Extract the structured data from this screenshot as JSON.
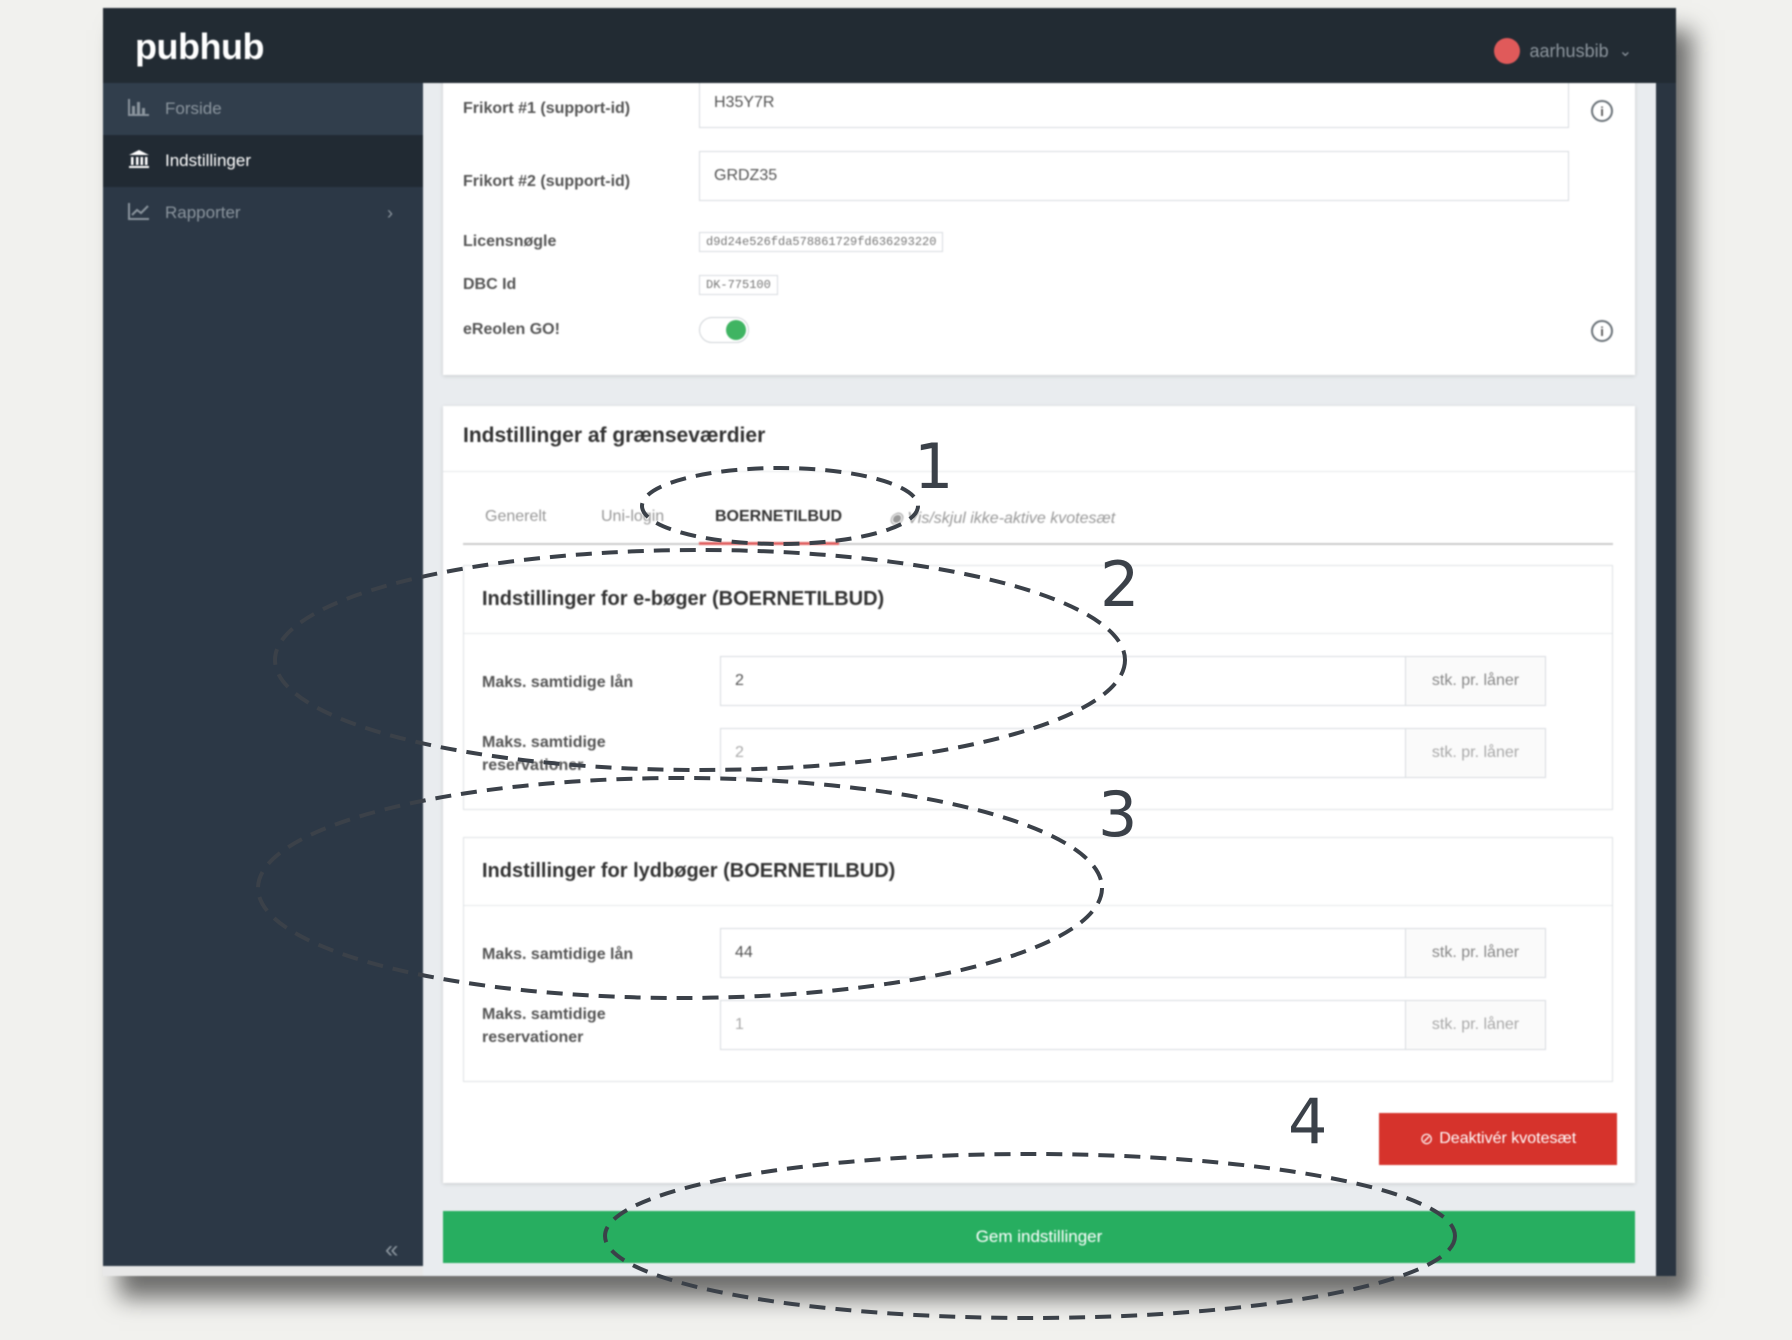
{
  "app": {
    "logo": "pubhub",
    "user": "aarhusbib",
    "user_chevron": "⌄"
  },
  "sidebar": {
    "items": [
      {
        "label": "Forside",
        "icon": "bar-chart-icon"
      },
      {
        "label": "Indstillinger",
        "icon": "bank-icon"
      },
      {
        "label": "Rapporter",
        "icon": "line-chart-icon"
      }
    ],
    "collapse": "«"
  },
  "settings": {
    "frikort1_label": "Frikort #1 (support-id)",
    "frikort1_value": "H35Y7R",
    "frikort2_label": "Frikort #2 (support-id)",
    "frikort2_value": "GRDZ35",
    "license_label": "Licensnøgle",
    "license_value": "d9d24e526fda578861729fd636293220",
    "dbc_label": "DBC Id",
    "dbc_value": "DK-775100",
    "ereolen_label": "eReolen GO!",
    "ereolen_on": true
  },
  "limits": {
    "title": "Indstillinger af grænseværdier",
    "tabs": [
      "Generelt",
      "Uni-login",
      "BOERNETILBUD",
      "Vis/skjul ikke-aktive kvotesæt"
    ],
    "active_tab": "BOERNETILBUD",
    "ebooks": {
      "title": "Indstillinger for e-bøger (BOERNETILBUD)",
      "loans_label": "Maks. samtidige lån",
      "loans_value": "2",
      "reservations_label": "Maks. samtidige reservationer",
      "reservations_value": "2",
      "unit": "stk. pr. låner"
    },
    "audiobooks": {
      "title": "Indstillinger for lydbøger (BOERNETILBUD)",
      "loans_label": "Maks. samtidige lån",
      "loans_value": "44",
      "reservations_label": "Maks. samtidige reservationer",
      "reservations_value": "1",
      "unit": "stk. pr. låner"
    },
    "deactivate_label": "Deaktivér kvotesæt"
  },
  "save_label": "Gem indstillinger",
  "annotations": [
    "1",
    "2",
    "3",
    "4"
  ],
  "colors": {
    "topbar": "#222b33",
    "sidebar": "#2c3846",
    "save": "#27ae60",
    "deactivate": "#d6332c",
    "toggle_on": "#3fb462"
  }
}
